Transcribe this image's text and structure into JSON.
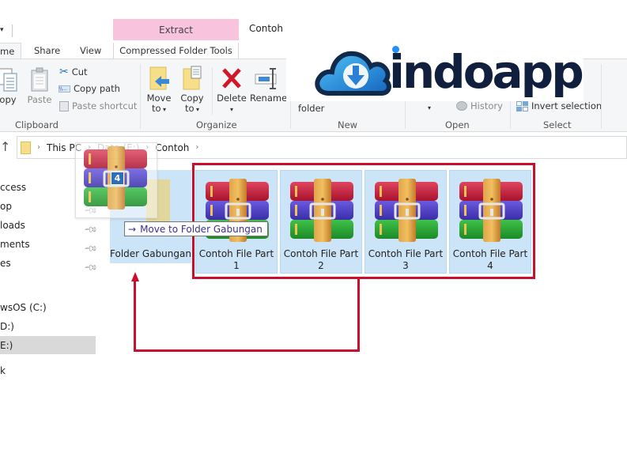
{
  "window": {
    "title": "Contoh",
    "context_tab_header": "Extract"
  },
  "tabs": [
    {
      "label": "me",
      "active": true
    },
    {
      "label": "Share"
    },
    {
      "label": "View"
    },
    {
      "label": "Compressed Folder Tools"
    }
  ],
  "ribbon": {
    "clipboard": {
      "label": "Clipboard",
      "copy": "opy",
      "paste": "Paste",
      "cut": "Cut",
      "copy_path": "Copy path",
      "paste_shortcut": "Paste shortcut"
    },
    "organize": {
      "label": "Organize",
      "move_to": [
        "Move",
        "to"
      ],
      "copy_to": [
        "Copy",
        "to"
      ],
      "delete": "Delete",
      "rename": "Rename"
    },
    "new": {
      "label": "New",
      "new_folder": "folder"
    },
    "open": {
      "label": "Open",
      "history": "History"
    },
    "select": {
      "label": "Select",
      "invert_selection": "Invert selection"
    }
  },
  "logo": {
    "text": "indoapp"
  },
  "address_bar": {
    "crumbs": [
      "This PC",
      "Data (E:)",
      "Contoh"
    ]
  },
  "sidebar": {
    "items": [
      {
        "label": "ccess",
        "pinned": false
      },
      {
        "label": "op",
        "pinned": true
      },
      {
        "label": "loads",
        "pinned": true
      },
      {
        "label": "ments",
        "pinned": true
      },
      {
        "label": "es",
        "pinned": true
      },
      {
        "label": "wsOS (C:)"
      },
      {
        "label": "D:)"
      },
      {
        "label": "E:)",
        "selected": true
      },
      {
        "label": "k"
      }
    ]
  },
  "content": {
    "folder": {
      "name": "Folder Gabungan"
    },
    "files": [
      {
        "name_line1": "Contoh File Part",
        "name_line2": "1"
      },
      {
        "name_line1": "Contoh File Part",
        "name_line2": "2"
      },
      {
        "name_line1": "Contoh File Part",
        "name_line2": "3"
      },
      {
        "name_line1": "Contoh File Part",
        "name_line2": "4"
      }
    ],
    "drag": {
      "count": "4",
      "tooltip": "Move to Folder Gabungan"
    }
  },
  "colors": {
    "annotation_red": "#c8102e",
    "selection_blue": "#cce4f7",
    "context_tab_pink": "#f8c3dc"
  }
}
